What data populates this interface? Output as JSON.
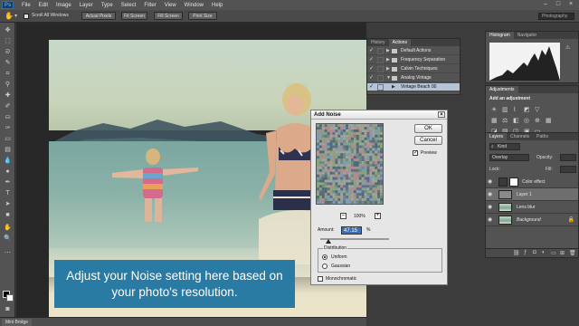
{
  "app": {
    "logo": "Ps",
    "menu": [
      "File",
      "Edit",
      "Image",
      "Layer",
      "Type",
      "Select",
      "Filter",
      "View",
      "Window",
      "Help"
    ],
    "window_controls": [
      "–",
      "□",
      "×"
    ]
  },
  "options_bar": {
    "scroll_all_windows": "Scroll All Windows",
    "actual_pixels": "Actual Pixels",
    "fit_screen": "Fit Screen",
    "fill_screen": "Fill Screen",
    "print_size": "Print Size",
    "workspace": "Photography"
  },
  "actions_panel": {
    "tabs": [
      "History",
      "Actions"
    ],
    "rows": [
      {
        "label": "Default Actions"
      },
      {
        "label": "Frequency Separation"
      },
      {
        "label": "Calvin Techniques"
      },
      {
        "label": "Analog Vintage"
      },
      {
        "label": "Vintage Beach 00"
      }
    ]
  },
  "histogram_panel": {
    "tabs": [
      "Histogram",
      "Navigator"
    ]
  },
  "adjustments_panel": {
    "tab": "Adjustments",
    "heading": "Add an adjustment"
  },
  "layers_panel": {
    "tabs": [
      "Layers",
      "Channels",
      "Paths"
    ],
    "kind": "Kind",
    "blend_mode": "Overlay",
    "opacity_label": "Opacity:",
    "lock_label": "Lock:",
    "fill_label": "Fill:",
    "layers": [
      {
        "name": "Color effect"
      },
      {
        "name": "Layer 1"
      },
      {
        "name": "Lens blur"
      },
      {
        "name": "Background"
      }
    ]
  },
  "dialog": {
    "title": "Add Noise",
    "ok": "OK",
    "cancel": "Cancel",
    "preview_label": "Preview",
    "preview_checked": true,
    "zoom": "100%",
    "zoom_out": "–",
    "zoom_in": "+",
    "amount_label": "Amount:",
    "amount_value": "47.15",
    "amount_unit": "%",
    "amount_fraction": 0.12,
    "distribution_legend": "Distribution",
    "uniform": "Uniform",
    "gaussian": "Gaussian",
    "selected_distribution": "Uniform",
    "monochromatic": "Monochromatic",
    "monochromatic_checked": false
  },
  "caption": {
    "text": "Adjust your Noise setting here based on your photo's resolution."
  },
  "mini_bridge": {
    "tab": "Mini Bridge"
  },
  "colors": {
    "caption_bg": "#2a7ba3",
    "selected_action_bg": "#b4c4d6",
    "amount_highlight": "#3d6fb5"
  }
}
